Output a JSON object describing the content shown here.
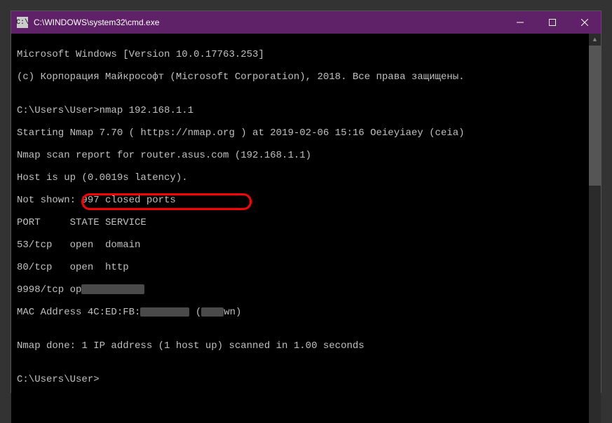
{
  "titlebar": {
    "icon_label": "C:\\",
    "title": "C:\\WINDOWS\\system32\\cmd.exe"
  },
  "terminal": {
    "line1": "Microsoft Windows [Version 10.0.17763.253]",
    "line2": "(c) Корпорация Майкрософт (Microsoft Corporation), 2018. Все права защищены.",
    "blank1": "",
    "prompt1_prefix": "C:\\Users\\User>",
    "prompt1_cmd": "nmap 192.168.1.1",
    "line4": "Starting Nmap 7.70 ( https://nmap.org ) at 2019-02-06 15:16 Oeieyiaey (ceia)",
    "line5": "Nmap scan report for router.asus.com (192.168.1.1)",
    "line6": "Host is up (0.0019s latency).",
    "line7": "Not shown: 997 closed ports",
    "line8": "PORT     STATE SERVICE",
    "line9": "53/tcp   open  domain",
    "line10": "80/tcp   open  http",
    "line11_a": "9998/tcp op",
    "mac_label": "MAC Address",
    "mac_value_visible": " 4C:ED:FB:",
    "mac_paren_open": " (",
    "mac_paren_suffix": "wn)",
    "blank2": "",
    "line13": "Nmap done: 1 IP address (1 host up) scanned in 1.00 seconds",
    "blank3": "",
    "prompt2": "C:\\Users\\User>"
  }
}
